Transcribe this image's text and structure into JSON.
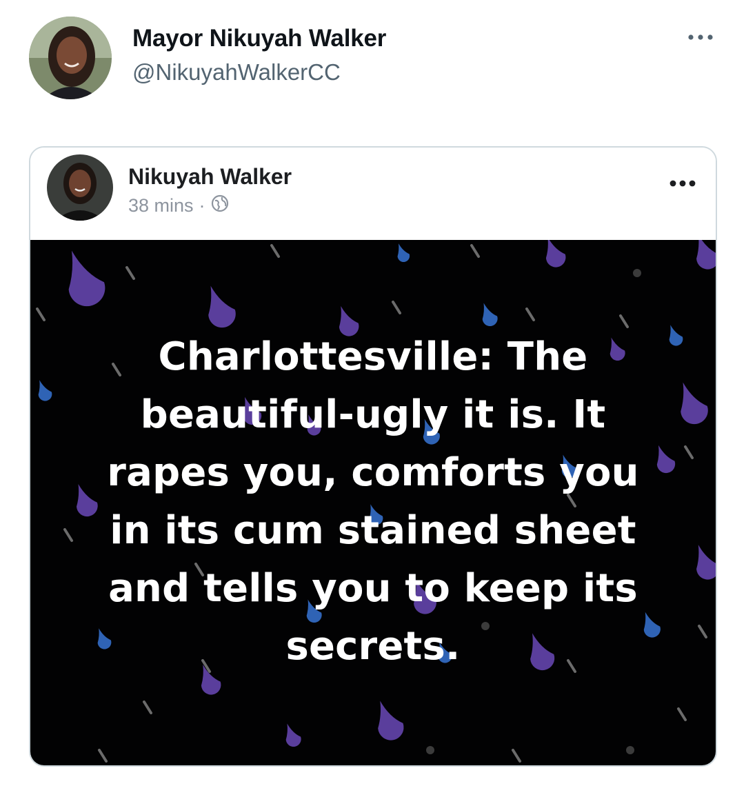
{
  "tweet": {
    "author_name": "Mayor Nikuyah Walker",
    "author_handle": "@NikuyahWalkerCC",
    "more_icon": "more-horizontal-icon"
  },
  "embed": {
    "name": "Nikuyah Walker",
    "time": "38 mins",
    "separator": "·",
    "audience_icon": "globe-icon",
    "more_icon": "more-horizontal-icon",
    "post_text": "Charlottesville: The\nbeautiful-ugly it is. It\nrapes you, comforts you\nin its cum stained sheet\nand tells you to keep its\nsecrets.",
    "background_color": "#020203",
    "raindrop_colors": [
      "#5a3e9c",
      "#2f63b5",
      "#6b6b6b"
    ]
  }
}
